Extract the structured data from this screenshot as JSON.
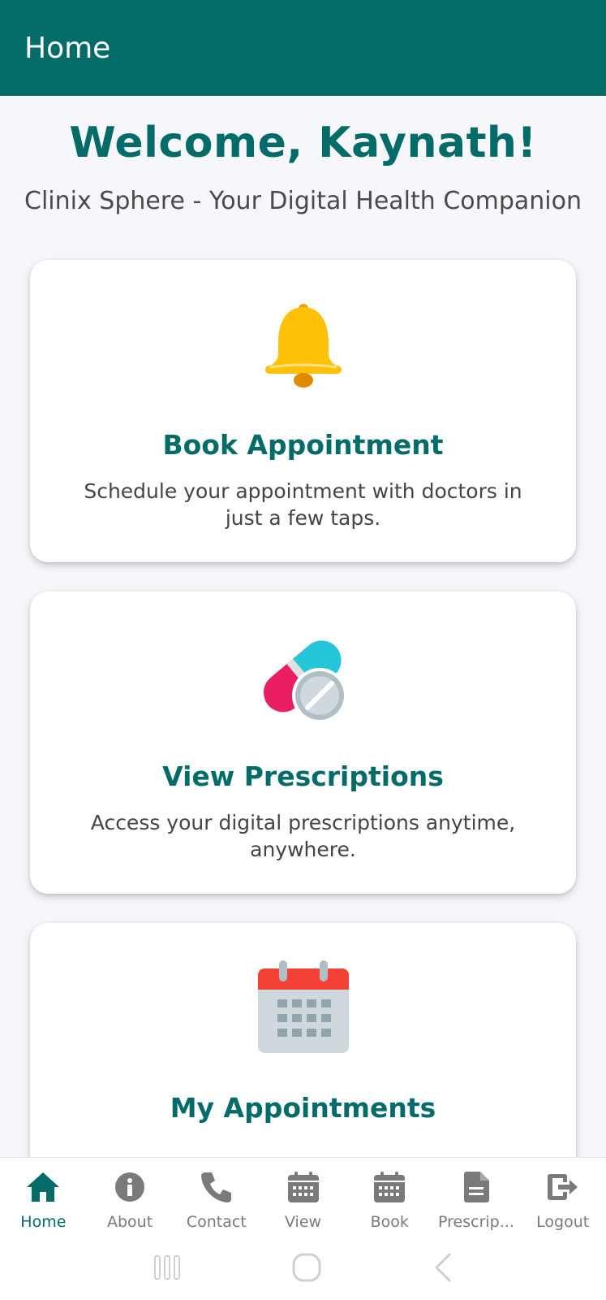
{
  "app_bar": {
    "title": "Home"
  },
  "welcome": {
    "heading": "Welcome, Kaynath!",
    "subtitle": "Clinix Sphere - Your Digital Health Companion"
  },
  "cards": [
    {
      "icon": "bell-icon",
      "title": "Book Appointment",
      "description": "Schedule your appointment with doctors in just a few taps."
    },
    {
      "icon": "pills-icon",
      "title": "View Prescriptions",
      "description": "Access your digital prescriptions anytime, anywhere."
    },
    {
      "icon": "calendar-icon",
      "title": "My Appointments",
      "description": ""
    }
  ],
  "bottom_nav": {
    "items": [
      {
        "label": "Home",
        "icon": "home-icon",
        "active": true
      },
      {
        "label": "About",
        "icon": "info-icon",
        "active": false
      },
      {
        "label": "Contact",
        "icon": "phone-icon",
        "active": false
      },
      {
        "label": "View",
        "icon": "calendar-grid-icon",
        "active": false
      },
      {
        "label": "Book",
        "icon": "calendar-grid-icon",
        "active": false
      },
      {
        "label": "Prescrip...",
        "icon": "document-icon",
        "active": false
      },
      {
        "label": "Logout",
        "icon": "logout-icon",
        "active": false
      }
    ]
  },
  "colors": {
    "primary": "#036b68",
    "background": "#f5f7fa",
    "inactive": "#7a7a7a"
  }
}
